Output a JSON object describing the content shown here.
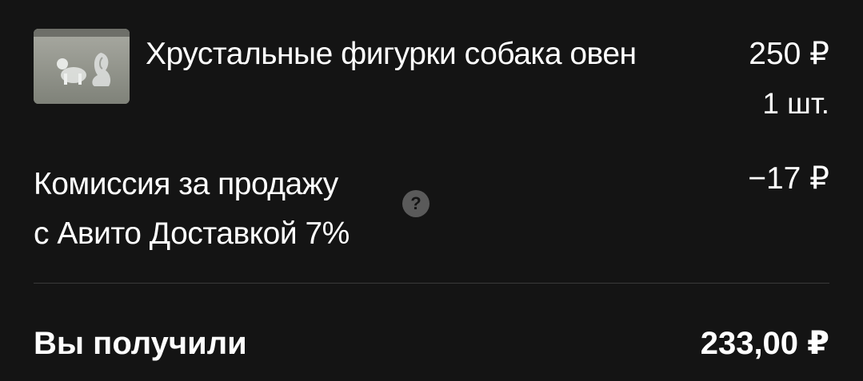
{
  "item": {
    "title": "Хрустальные фигурки собака овен",
    "price": "250 ₽",
    "quantity": "1 шт.",
    "thumbnail_icon": "crystal-figurines-photo"
  },
  "fee": {
    "line1": "Комиссия за продажу",
    "line2": "с Авито Доставкой 7%",
    "amount": "−17 ₽",
    "help_symbol": "?"
  },
  "total": {
    "label": "Вы получили",
    "amount": "233,00 ₽"
  },
  "colors": {
    "background": "#141414",
    "text": "#ffffff",
    "divider": "#3a3a3a",
    "help_button": "#5a5a5a"
  }
}
